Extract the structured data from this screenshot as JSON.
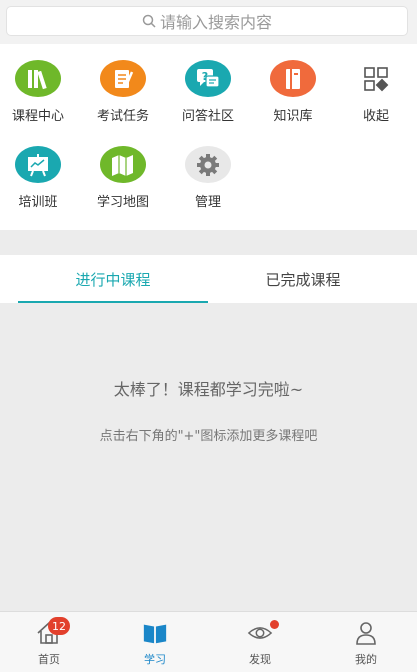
{
  "search": {
    "placeholder": "请输入搜索内容"
  },
  "grid": {
    "items": [
      {
        "label": "课程中心",
        "icon": "books-icon",
        "color": "#6fb82a"
      },
      {
        "label": "考试任务",
        "icon": "exam-icon",
        "color": "#f2891b"
      },
      {
        "label": "问答社区",
        "icon": "qa-icon",
        "color": "#1aa8b0"
      },
      {
        "label": "知识库",
        "icon": "book-icon",
        "color": "#f06a3c"
      },
      {
        "label": "收起",
        "icon": "collapse-grid-icon",
        "color": "#555555"
      },
      {
        "label": "培训班",
        "icon": "training-board-icon",
        "color": "#1aa8b0"
      },
      {
        "label": "学习地图",
        "icon": "map-icon",
        "color": "#6fb82a"
      },
      {
        "label": "管理",
        "icon": "gear-icon",
        "color": "#e8e8e8"
      }
    ]
  },
  "tabs": {
    "active": "进行中课程",
    "inactive": "已完成课程"
  },
  "empty": {
    "title": "太棒了！课程都学习完啦~",
    "subtitle": "点击右下角的\"+\"图标添加更多课程吧"
  },
  "bottom_nav": {
    "home": {
      "label": "首页",
      "badge": "12"
    },
    "study": {
      "label": "学习"
    },
    "discover": {
      "label": "发现"
    },
    "mine": {
      "label": "我的"
    }
  },
  "colors": {
    "accent": "#1aa8b0",
    "nav_active": "#1a86c8",
    "badge": "#e2402c"
  }
}
